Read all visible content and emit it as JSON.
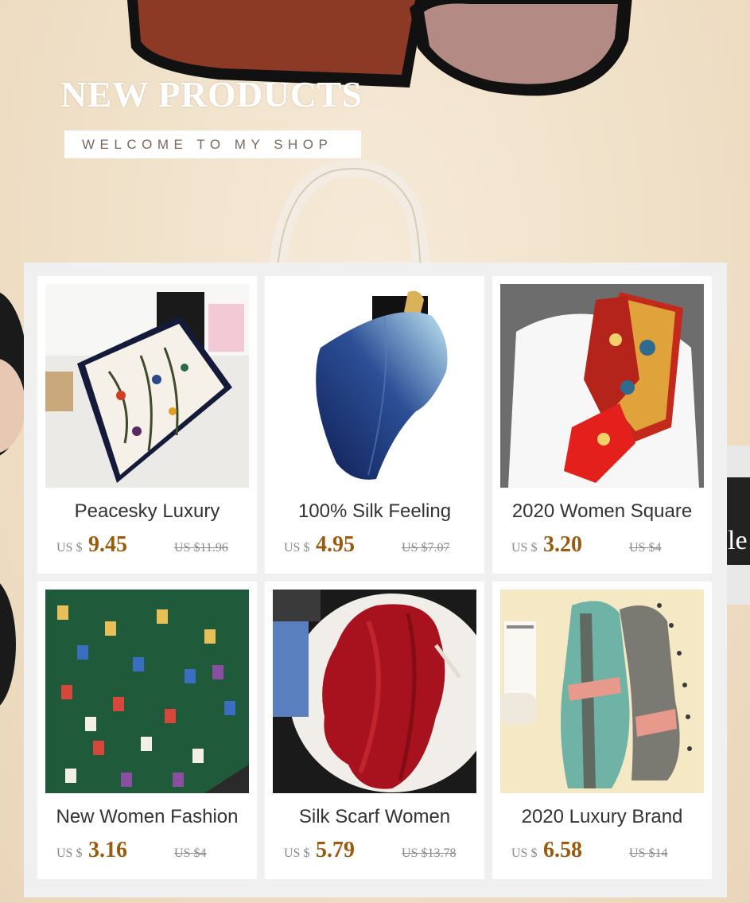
{
  "hero": {
    "title": "NEW PRODUCTS",
    "subtitle": "WELCOME TO MY SHOP"
  },
  "colors": {
    "price": "#9a5b0e",
    "background": "#f1e3cd",
    "panel": "#f0f0f0"
  },
  "products": [
    {
      "name": "Peacesky Luxury",
      "currency": "US $",
      "price": "9.45",
      "original_price": "US $11.96",
      "image": "white-floral-silk-scarf"
    },
    {
      "name": "100% Silk Feeling",
      "currency": "US $",
      "price": "4.95",
      "original_price": "US $7.07",
      "image": "navy-gradient-silk-scarf"
    },
    {
      "name": "2020 Women Square",
      "currency": "US $",
      "price": "3.20",
      "original_price": "US $4",
      "image": "red-paisley-square-scarf"
    },
    {
      "name": "New Women Fashion",
      "currency": "US $",
      "price": "3.16",
      "original_price": "US $4",
      "image": "green-cat-print-scarf"
    },
    {
      "name": "Silk Scarf Women",
      "currency": "US $",
      "price": "5.79",
      "original_price": "US $13.78",
      "image": "burgundy-satin-scarf"
    },
    {
      "name": "2020 Luxury Brand",
      "currency": "US $",
      "price": "6.58",
      "original_price": "US $14",
      "image": "teal-striped-long-scarf"
    }
  ]
}
